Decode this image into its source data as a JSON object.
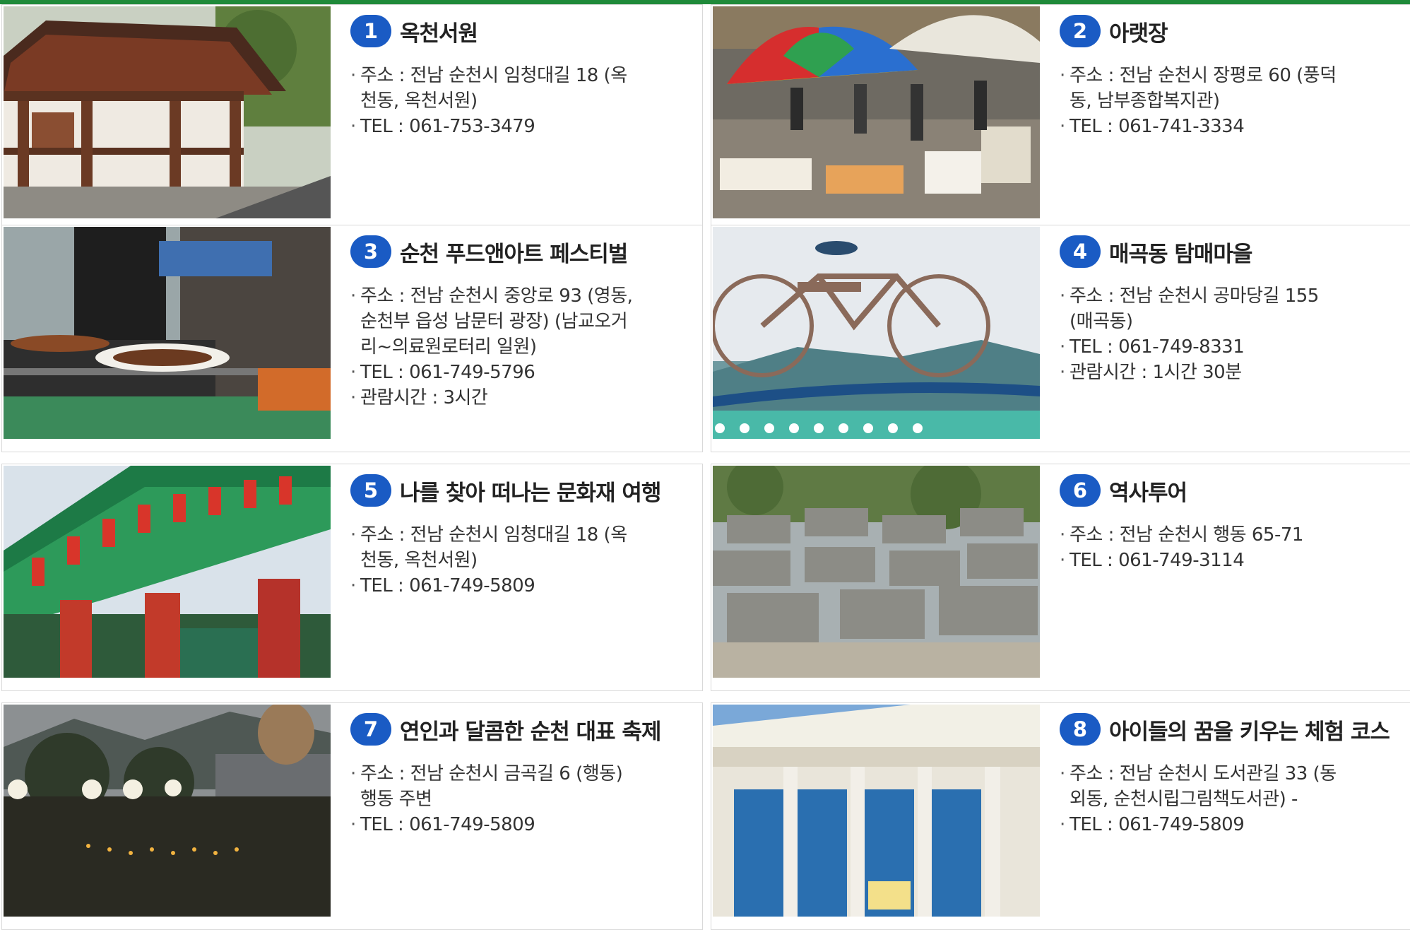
{
  "theme": {
    "accent": "#1f8a3a",
    "badge": "#1a5bc4"
  },
  "items": [
    {
      "number": "1",
      "title": "옥천서원",
      "image": "hanok-building-photo",
      "details": [
        "주소 : 전남 순천시 임청대길 18 (옥\n천동, 옥천서원)",
        "TEL : 061-753-3479"
      ]
    },
    {
      "number": "2",
      "title": "아랫장",
      "image": "market-umbrella-photo",
      "details": [
        "주소 : 전남 순천시 장평로 60 (풍덕\n동, 남부종합복지관)",
        "TEL : 061-741-3334"
      ]
    },
    {
      "number": "3",
      "title": "순천 푸드앤아트 페스티벌",
      "image": "grill-festival-photo",
      "details": [
        "주소 : 전남 순천시 중앙로 93 (영동,\n순천부 읍성 남문터 광장) (남교오거\n리~의료원로터리 일원)",
        "TEL : 061-749-5796",
        "관람시간 : 3시간"
      ]
    },
    {
      "number": "4",
      "title": "매곡동 탐매마을",
      "image": "bicycle-sculpture-photo",
      "details": [
        "주소 : 전남 순천시 공마당길 155\n(매곡동)",
        "TEL : 061-749-8331",
        "관람시간 : 1시간 30분"
      ]
    },
    {
      "number": "5",
      "title": "나를 찾아 떠나는 문화재 여행",
      "image": "dancheong-eaves-photo",
      "details": [
        "주소 : 전남 순천시 임청대길 18 (옥\n천동, 옥천서원)",
        "TEL : 061-749-5809"
      ]
    },
    {
      "number": "6",
      "title": "역사투어",
      "image": "old-village-set-photo",
      "details": [
        "주소 : 전남 순천시 행동 65-71",
        "TEL : 061-749-3114"
      ]
    },
    {
      "number": "7",
      "title": "연인과 달콤한 순천 대표 축제",
      "image": "night-lantern-park-photo",
      "details": [
        "주소 : 전남 순천시 금곡길 6 (행동)\n행동 주변",
        "TEL : 061-749-5809"
      ]
    },
    {
      "number": "8",
      "title": "아이들의 꿈을 키우는 체험 코스",
      "image": "library-building-photo",
      "details": [
        "주소 : 전남 순천시 도서관길 33 (동\n외동, 순천시립그림책도서관) -",
        "TEL : 061-749-5809"
      ]
    }
  ]
}
